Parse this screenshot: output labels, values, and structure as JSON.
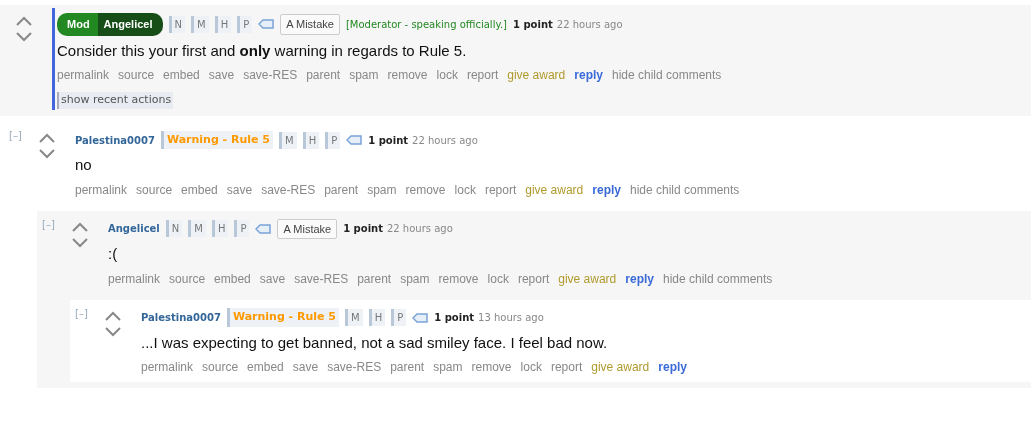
{
  "comments": [
    {
      "mod_badge": {
        "label": "Mod",
        "name": "Angelicel"
      },
      "tags": [
        "N",
        "M",
        "H",
        "P"
      ],
      "user_tag": "A Mistake",
      "note": "[Moderator - speaking officially.]",
      "score": "1 point",
      "time": "22 hours ago",
      "body": "Consider this your first and **only** warning in regards to Rule 5.",
      "moderator_bar": true,
      "actions": [
        {
          "label": "permalink",
          "kind": "plain"
        },
        {
          "label": "source",
          "kind": "plain"
        },
        {
          "label": "embed",
          "kind": "plain"
        },
        {
          "label": "save",
          "kind": "plain"
        },
        {
          "label": "save-RES",
          "kind": "plain"
        },
        {
          "label": "parent",
          "kind": "plain"
        },
        {
          "label": "spam",
          "kind": "plain"
        },
        {
          "label": "remove",
          "kind": "plain"
        },
        {
          "label": "lock",
          "kind": "plain"
        },
        {
          "label": "report",
          "kind": "plain"
        },
        {
          "label": "give award",
          "kind": "award"
        },
        {
          "label": "reply",
          "kind": "reply"
        },
        {
          "label": "hide child comments",
          "kind": "plain"
        }
      ],
      "recent_actions": "show recent actions"
    },
    {
      "toggle": "[–]",
      "author": "Palestina0007",
      "flair": "Warning - Rule 5",
      "tags": [
        "M",
        "H",
        "P"
      ],
      "score": "1 point",
      "time": "22 hours ago",
      "body": "no",
      "moderator_bar": false,
      "actions": [
        {
          "label": "permalink",
          "kind": "plain"
        },
        {
          "label": "source",
          "kind": "plain"
        },
        {
          "label": "embed",
          "kind": "plain"
        },
        {
          "label": "save",
          "kind": "plain"
        },
        {
          "label": "save-RES",
          "kind": "plain"
        },
        {
          "label": "parent",
          "kind": "plain"
        },
        {
          "label": "spam",
          "kind": "plain"
        },
        {
          "label": "remove",
          "kind": "plain"
        },
        {
          "label": "lock",
          "kind": "plain"
        },
        {
          "label": "report",
          "kind": "plain"
        },
        {
          "label": "give award",
          "kind": "award"
        },
        {
          "label": "reply",
          "kind": "reply"
        },
        {
          "label": "hide child comments",
          "kind": "plain"
        }
      ],
      "children": [
        {
          "toggle": "[–]",
          "author": "Angelicel",
          "tags": [
            "N",
            "M",
            "H",
            "P"
          ],
          "user_tag": "A Mistake",
          "score": "1 point",
          "time": "22 hours ago",
          "body": ":(",
          "moderator_bar": false,
          "actions": [
            {
              "label": "permalink",
              "kind": "plain"
            },
            {
              "label": "source",
              "kind": "plain"
            },
            {
              "label": "embed",
              "kind": "plain"
            },
            {
              "label": "save",
              "kind": "plain"
            },
            {
              "label": "save-RES",
              "kind": "plain"
            },
            {
              "label": "parent",
              "kind": "plain"
            },
            {
              "label": "spam",
              "kind": "plain"
            },
            {
              "label": "remove",
              "kind": "plain"
            },
            {
              "label": "lock",
              "kind": "plain"
            },
            {
              "label": "report",
              "kind": "plain"
            },
            {
              "label": "give award",
              "kind": "award"
            },
            {
              "label": "reply",
              "kind": "reply"
            },
            {
              "label": "hide child comments",
              "kind": "plain"
            }
          ],
          "children": [
            {
              "toggle": "[–]",
              "author": "Palestina0007",
              "flair": "Warning - Rule 5",
              "tags": [
                "M",
                "H",
                "P"
              ],
              "score": "1 point",
              "time": "13 hours ago",
              "body": "...I was expecting to get banned, not a sad smiley face. I feel bad now.",
              "moderator_bar": false,
              "actions": [
                {
                  "label": "permalink",
                  "kind": "plain"
                },
                {
                  "label": "source",
                  "kind": "plain"
                },
                {
                  "label": "embed",
                  "kind": "plain"
                },
                {
                  "label": "save",
                  "kind": "plain"
                },
                {
                  "label": "save-RES",
                  "kind": "plain"
                },
                {
                  "label": "parent",
                  "kind": "plain"
                },
                {
                  "label": "spam",
                  "kind": "plain"
                },
                {
                  "label": "remove",
                  "kind": "plain"
                },
                {
                  "label": "lock",
                  "kind": "plain"
                },
                {
                  "label": "report",
                  "kind": "plain"
                },
                {
                  "label": "give award",
                  "kind": "award"
                },
                {
                  "label": "reply",
                  "kind": "reply"
                }
              ]
            }
          ]
        }
      ]
    }
  ]
}
